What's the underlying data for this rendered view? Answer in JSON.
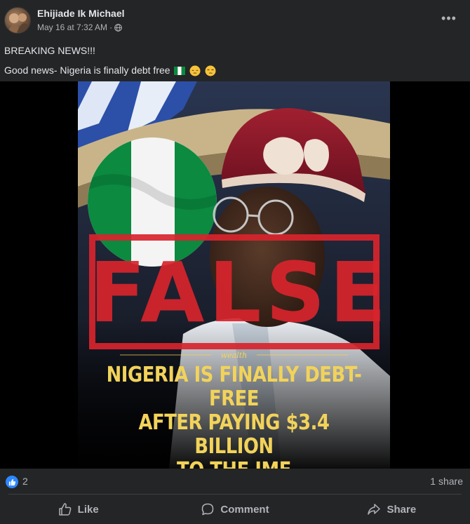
{
  "post": {
    "author": "Ehijiade Ik Michael",
    "timestamp": "May 16 at 7:32 AM",
    "separator": "·",
    "privacy_icon": "globe-icon",
    "more_label": "•••",
    "text_line1": "BREAKING NEWS!!!",
    "text_line2": "Good news- Nigeria is finally debt free",
    "emojis": [
      "nigeria-flag",
      "pensive-face",
      "unamused-face"
    ]
  },
  "media": {
    "stamp": "FALSE",
    "brand": "wealth",
    "headline": [
      "NIGERIA IS FINALLY DEBT-FREE",
      "AFTER PAYING $3.4 BILLION",
      "TO THE IMF"
    ]
  },
  "stats": {
    "like_count": "2",
    "share_count": "1 share"
  },
  "actions": {
    "like": "Like",
    "comment": "Comment",
    "share": "Share"
  },
  "colors": {
    "background": "#242526",
    "text": "#e4e6eb",
    "secondary": "#b0b3b8",
    "accent": "#2d88ff",
    "stamp": "#d8242c",
    "headline": "#f2d35a"
  }
}
